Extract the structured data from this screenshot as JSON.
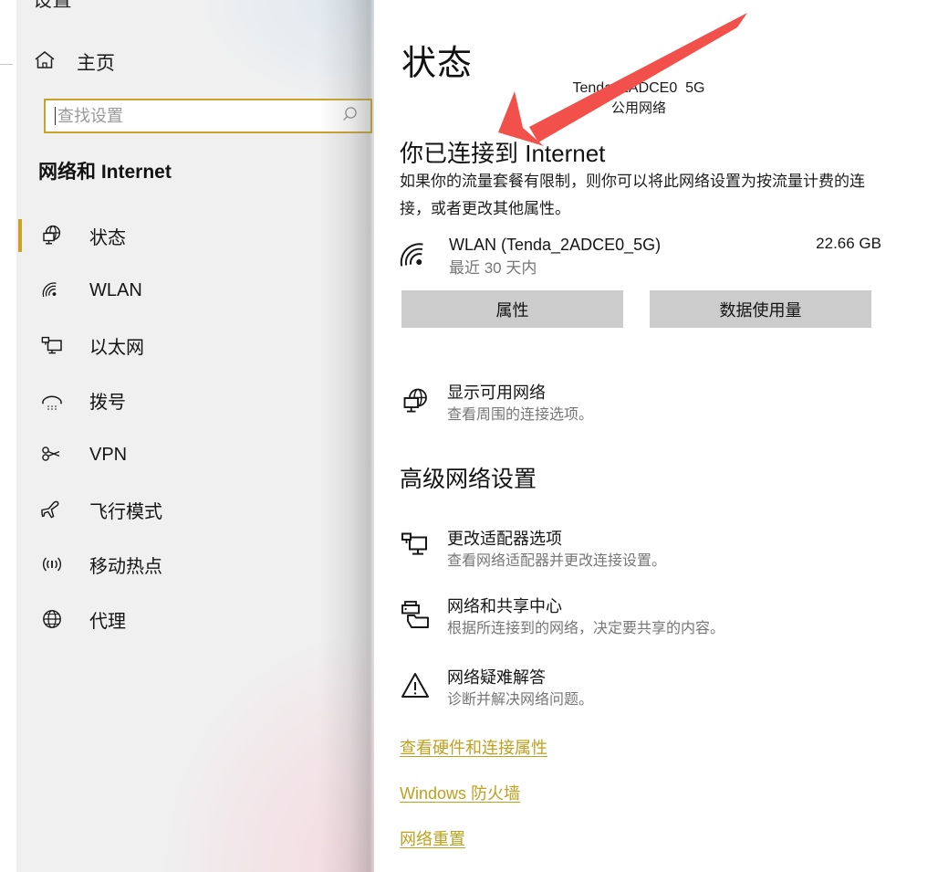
{
  "window": {
    "app_title": "设置"
  },
  "sidebar": {
    "home_label": "主页",
    "home_icon": "home-icon",
    "search": {
      "placeholder": "查找设置",
      "value": "",
      "icon": "search-icon"
    },
    "category_title": "网络和 Internet",
    "accent_color": "#C9A227",
    "items": [
      {
        "label": "状态",
        "icon": "globe-monitor-icon",
        "selected": true
      },
      {
        "label": "WLAN",
        "icon": "wifi-icon",
        "selected": false
      },
      {
        "label": "以太网",
        "icon": "ethernet-icon",
        "selected": false
      },
      {
        "label": "拨号",
        "icon": "dialup-phone-icon",
        "selected": false
      },
      {
        "label": "VPN",
        "icon": "vpn-key-icon",
        "selected": false
      },
      {
        "label": "飞行模式",
        "icon": "airplane-icon",
        "selected": false
      },
      {
        "label": "移动热点",
        "icon": "hotspot-icon",
        "selected": false
      },
      {
        "label": "代理",
        "icon": "globe-icon",
        "selected": false
      }
    ]
  },
  "main": {
    "page_title": "状态",
    "network_summary": {
      "ssid": "Tenda_2ADCE0_5G",
      "network_type": "公用网络"
    },
    "connection": {
      "heading": "你已连接到 Internet",
      "description": "如果你的流量套餐有限制，则你可以将此网络设置为按流量计费的连接，或者更改其他属性。"
    },
    "usage": {
      "icon": "wifi-icon",
      "name": "WLAN (Tenda_2ADCE0_5G)",
      "period": "最近 30 天内",
      "amount": "22.66 GB"
    },
    "buttons": {
      "properties": "属性",
      "data_usage": "数据使用量"
    },
    "show_networks": {
      "icon": "globe-monitor-icon",
      "title": "显示可用网络",
      "subtitle": "查看周围的连接选项。"
    },
    "advanced_title": "高级网络设置",
    "advanced_items": [
      {
        "icon": "monitor-adapter-icon",
        "title": "更改适配器选项",
        "subtitle": "查看网络适配器并更改连接设置。"
      },
      {
        "icon": "printer-folder-icon",
        "title": "网络和共享中心",
        "subtitle": "根据所连接到的网络，决定要共享的内容。"
      },
      {
        "icon": "warning-triangle-icon",
        "title": "网络疑难解答",
        "subtitle": "诊断并解决网络问题。"
      }
    ],
    "footer_links": [
      {
        "label": "查看硬件和连接属性"
      },
      {
        "label": "Windows 防火墙"
      },
      {
        "label": "网络重置"
      }
    ],
    "link_color": "#C0A01F"
  },
  "annotation": {
    "arrow_color": "#F2504B",
    "points_to": "网络重置"
  }
}
